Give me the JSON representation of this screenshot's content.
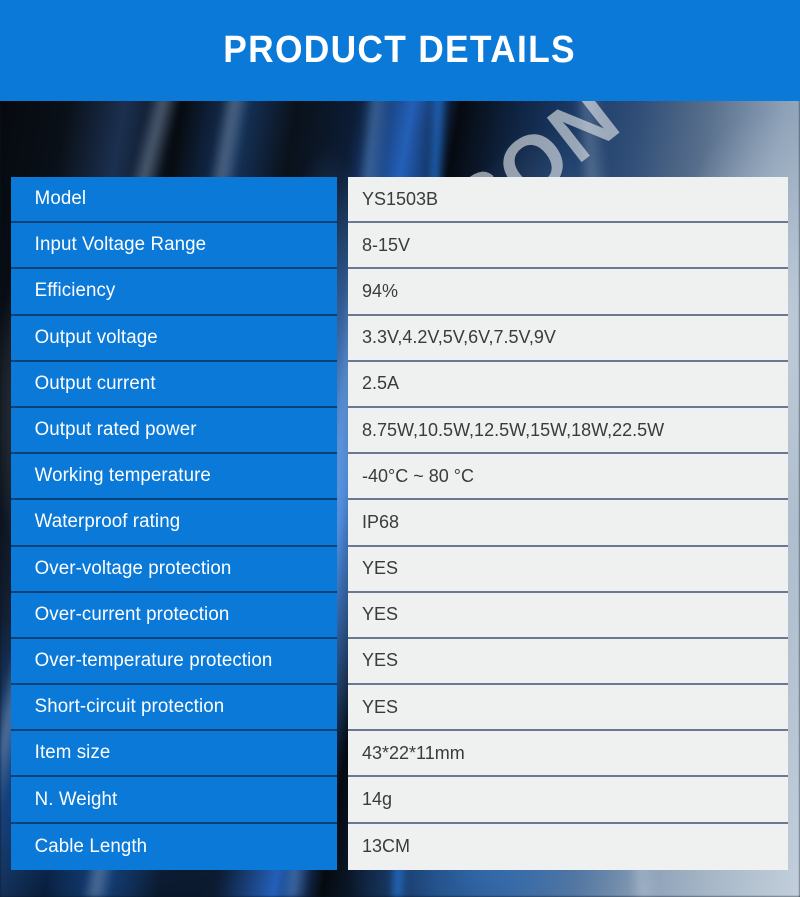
{
  "header": {
    "title": "PRODUCT DETAILS",
    "background_color": "#0a79d7",
    "text_color": "#ffffff"
  },
  "watermark": {
    "text": "YASON",
    "color": "#e4e6e8"
  },
  "theme": {
    "accent_blue": "#0a79d7",
    "value_cell_background": "#eff0f0",
    "value_text_color": "#3b3b3b",
    "label_text_color": "#ffffff"
  },
  "spec_table": {
    "rows": [
      {
        "label": "Model",
        "value": "YS1503B"
      },
      {
        "label": "Input Voltage Range",
        "value": "8-15V"
      },
      {
        "label": "Efficiency",
        "value": "94%"
      },
      {
        "label": "Output voltage",
        "value": "3.3V,4.2V,5V,6V,7.5V,9V"
      },
      {
        "label": "Output current",
        "value": "2.5A"
      },
      {
        "label": "Output rated power",
        "value": "8.75W,10.5W,12.5W,15W,18W,22.5W"
      },
      {
        "label": "Working temperature",
        "value": "-40°C ~ 80 °C"
      },
      {
        "label": "Waterproof rating",
        "value": "IP68"
      },
      {
        "label": "Over-voltage protection",
        "value": "YES"
      },
      {
        "label": "Over-current protection",
        "value": "YES"
      },
      {
        "label": "Over-temperature protection",
        "value": "YES"
      },
      {
        "label": "Short-circuit protection",
        "value": "YES"
      },
      {
        "label": "Item size",
        "value": "43*22*11mm"
      },
      {
        "label": "N. Weight",
        "value": "14g"
      },
      {
        "label": "Cable Length",
        "value": "13CM"
      }
    ]
  }
}
